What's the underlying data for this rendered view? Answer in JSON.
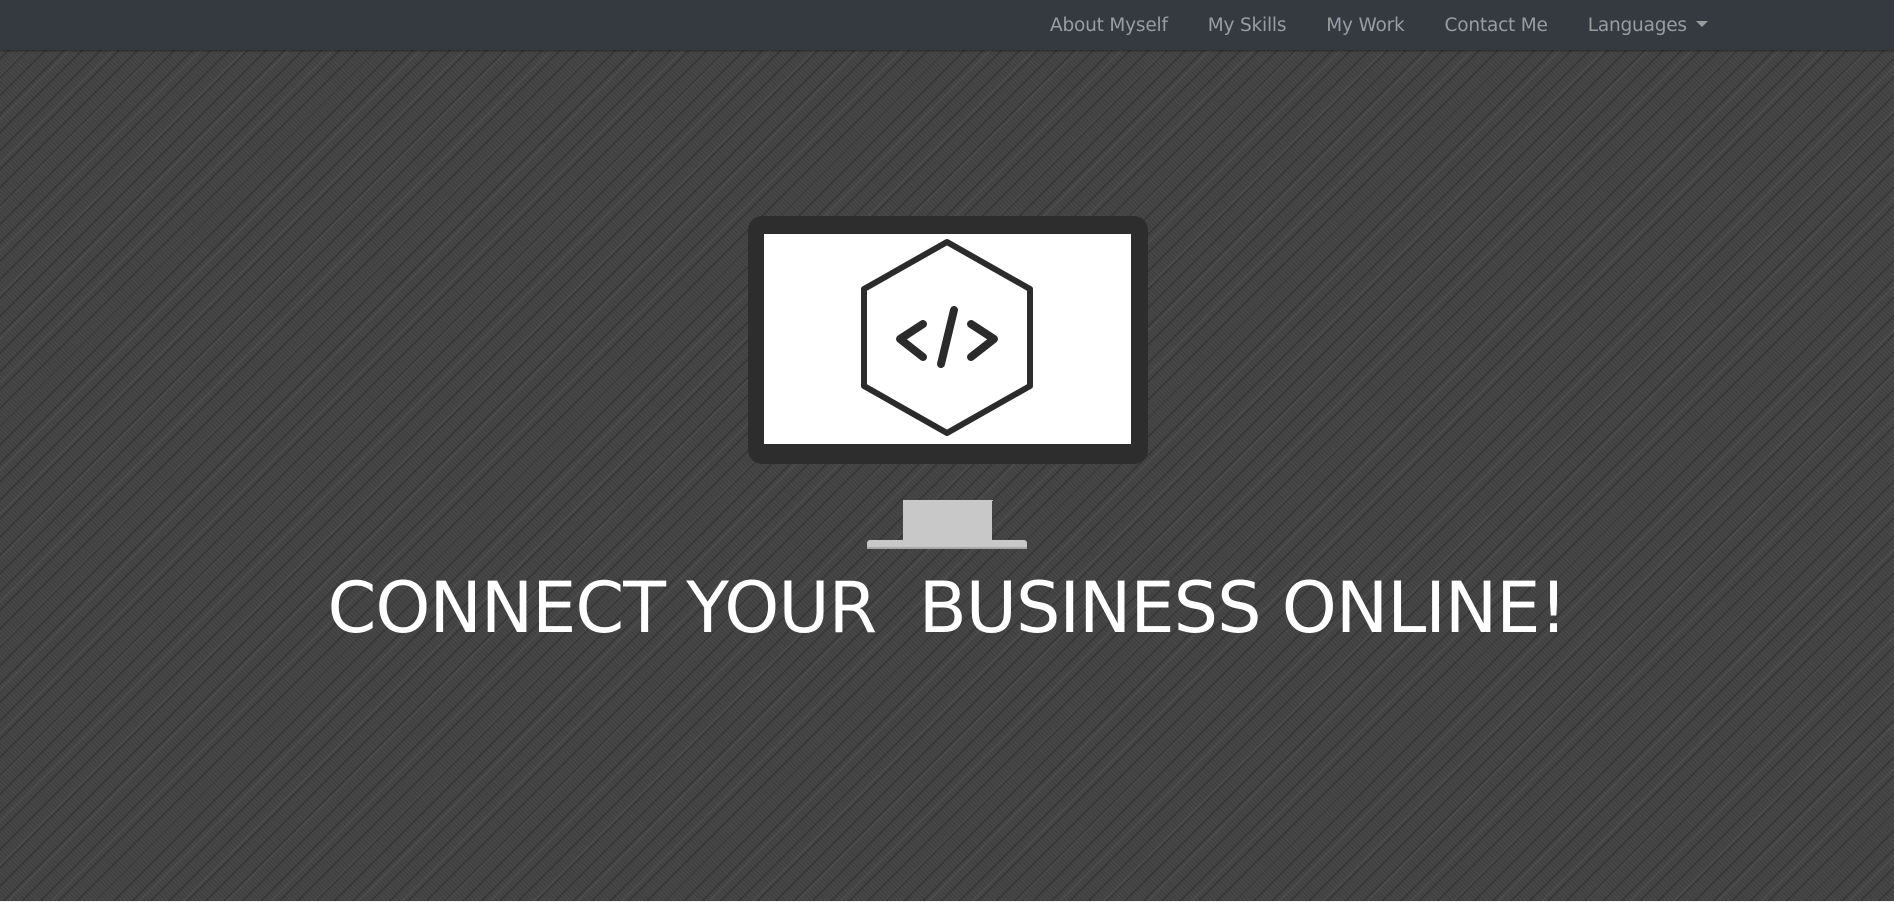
{
  "nav": {
    "items": [
      {
        "label": "About Myself"
      },
      {
        "label": "My Skills"
      },
      {
        "label": "My Work"
      },
      {
        "label": "Contact Me"
      }
    ],
    "languages_label": "Languages"
  },
  "hero": {
    "headline": "CONNECT YOUR  BUSINESS ONLINE!",
    "illustration_icon": "code-hexagon-icon"
  },
  "colors": {
    "navbar_bg": "#343a40",
    "nav_text": "#9a9da0",
    "hero_bg": "#424242",
    "headline": "#ffffff"
  }
}
